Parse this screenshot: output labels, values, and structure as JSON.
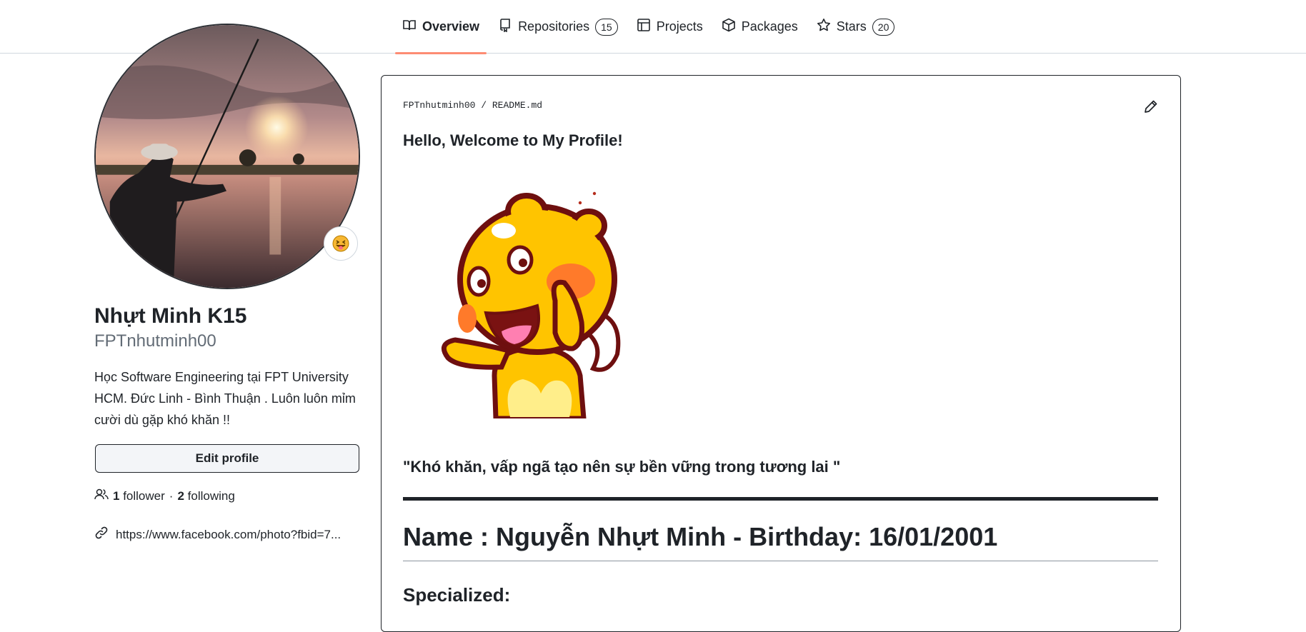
{
  "nav": {
    "tabs": [
      {
        "label": "Overview",
        "icon": "book-icon",
        "count": null,
        "active": true
      },
      {
        "label": "Repositories",
        "icon": "repo-icon",
        "count": "15",
        "active": false
      },
      {
        "label": "Projects",
        "icon": "table-icon",
        "count": null,
        "active": false
      },
      {
        "label": "Packages",
        "icon": "package-icon",
        "count": null,
        "active": false
      },
      {
        "label": "Stars",
        "icon": "star-icon",
        "count": "20",
        "active": false
      }
    ],
    "active_color": "#fd8c73"
  },
  "profile": {
    "full_name": "Nhựt Minh K15",
    "username": "FPTnhutminh00",
    "bio": "Học Software Engineering tại FPT University HCM. Đức Linh - Bình Thuận . Luôn luôn mỉm cười dù gặp khó khăn !!",
    "status_emoji": "😝",
    "edit_button": "Edit profile",
    "followers_count": "1",
    "followers_label": "follower",
    "separator": "·",
    "following_count": "2",
    "following_label": "following",
    "link": "https://www.facebook.com/photo?fbid=7..."
  },
  "readme": {
    "owner": "FPTnhutminh00",
    "slash": "/",
    "file": "README.md",
    "greeting": "Hello, Welcome to My Profile!",
    "quote": "\"Khó khăn, vấp ngã tạo nên sự bền vững trong tương lai \"",
    "heading": "Name : Nguyễn Nhựt Minh - Birthday: 16/01/2001",
    "subheading": "Specialized:"
  }
}
